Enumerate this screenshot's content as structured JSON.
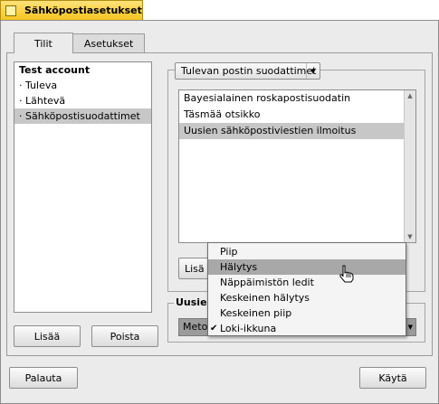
{
  "window": {
    "title": "Sähköpostiasetukset"
  },
  "tabs": [
    {
      "label": "Tilit",
      "active": true
    },
    {
      "label": "Asetukset",
      "active": false
    }
  ],
  "accounts": {
    "items": [
      {
        "label": "Test account",
        "kind": "header"
      },
      {
        "label": "· Tuleva"
      },
      {
        "label": "· Lähtevä"
      },
      {
        "label": "· Sähköpostisuodattimet",
        "selected": true
      }
    ],
    "add_button": "Lisää",
    "remove_button": "Poista"
  },
  "filters": {
    "selector_value": "Tulevan postin suodattimet",
    "list": [
      {
        "label": "Bayesialainen roskapostisuodatin"
      },
      {
        "label": "Täsmää otsikko"
      },
      {
        "label": "Uusien sähköpostiviestien ilmoitus",
        "selected": true
      }
    ],
    "add_button_partial": "Lisä"
  },
  "notification": {
    "group_title_partial": "Uusien",
    "method_label_partial": "Metodi"
  },
  "method_menu": {
    "items": [
      {
        "label": "Piip"
      },
      {
        "label": "Hälytys",
        "highlighted": true
      },
      {
        "label": "Näppäimistön ledit"
      },
      {
        "label": "Keskeinen hälytys"
      },
      {
        "label": "Keskeinen piip"
      },
      {
        "label": "Loki-ikkuna",
        "checked": true
      }
    ],
    "check_glyph": "✔"
  },
  "footer": {
    "revert_button": "Palauta",
    "apply_button": "Käytä"
  }
}
